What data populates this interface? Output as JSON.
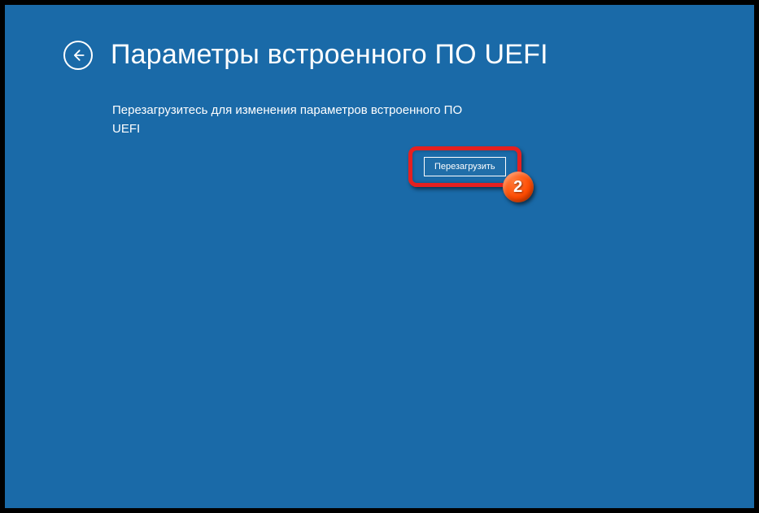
{
  "header": {
    "title": "Параметры встроенного ПО UEFI"
  },
  "main": {
    "description": "Перезагрузитесь для изменения параметров встроенного ПО UEFI"
  },
  "actions": {
    "restart_label": "Перезагрузить"
  },
  "annotation": {
    "step_number": "2"
  }
}
